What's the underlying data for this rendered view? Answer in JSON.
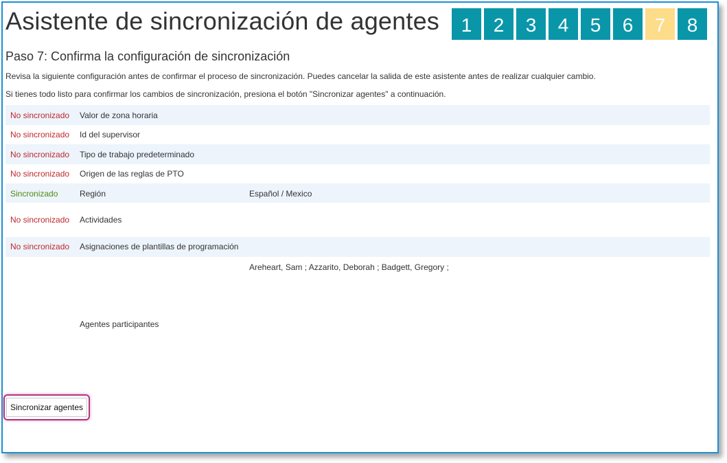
{
  "wizard": {
    "title": "Asistente de sincronización de agentes",
    "steps": [
      "1",
      "2",
      "3",
      "4",
      "5",
      "6",
      "7",
      "8"
    ],
    "current_step": 7,
    "colors": {
      "step": "#0a96a9",
      "current_step": "#fddc8a",
      "not_synced": "#c0272d",
      "synced": "#4f8a10"
    }
  },
  "step": {
    "subtitle": "Paso 7: Confirma la configuración de sincronización",
    "description1": "Revisa la siguiente configuración antes de confirmar el proceso de sincronización. Puedes cancelar la salida de este asistente antes de realizar cualquier cambio.",
    "description2": "Si tienes todo listo para confirmar los cambios de sincronización, presiona el botón \"Sincronizar agentes\" a continuación."
  },
  "settings": {
    "rows": [
      {
        "status": "No sincronizado",
        "synced": false,
        "setting": "Valor de zona horaria",
        "value": ""
      },
      {
        "status": "No sincronizado",
        "synced": false,
        "setting": "Id del supervisor",
        "value": ""
      },
      {
        "status": "No sincronizado",
        "synced": false,
        "setting": "Tipo de trabajo predeterminado",
        "value": ""
      },
      {
        "status": "No sincronizado",
        "synced": false,
        "setting": "Origen de las reglas de PTO",
        "value": ""
      },
      {
        "status": "Sincronizado",
        "synced": true,
        "setting": "Región",
        "value": "Español / Mexico"
      },
      {
        "status": "No sincronizado",
        "synced": false,
        "setting": "Actividades",
        "value": ""
      },
      {
        "status": "No sincronizado",
        "synced": false,
        "setting": "Asignaciones de plantillas de programación",
        "value": ""
      },
      {
        "status": "",
        "synced": null,
        "setting": "Agentes participantes",
        "value": "Areheart, Sam ; Azzarito, Deborah ; Badgett, Gregory ;"
      }
    ]
  },
  "actions": {
    "sync_label": "Sincronizar agentes"
  }
}
